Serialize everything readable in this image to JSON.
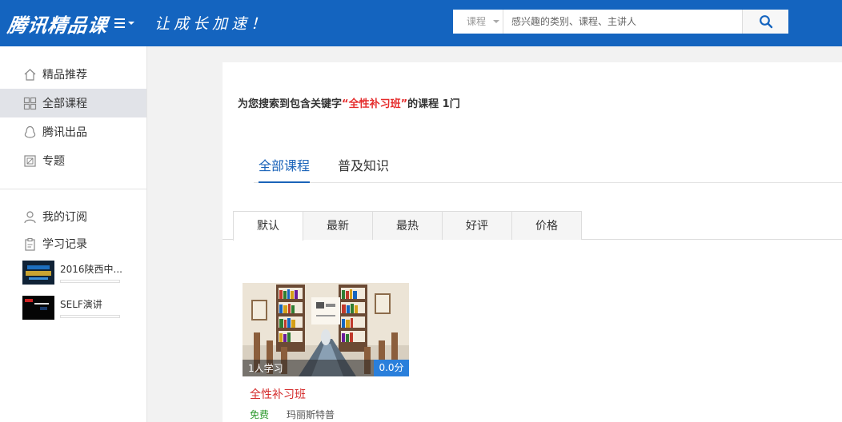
{
  "header": {
    "logo": "腾讯精品课",
    "slogan": "让成长加速！",
    "search": {
      "category": "课程",
      "placeholder": "感兴趣的类别、课程、主讲人"
    }
  },
  "sidebar": {
    "items": [
      {
        "label": "精品推荐",
        "icon": "home-icon"
      },
      {
        "label": "全部课程",
        "icon": "grid-icon",
        "active": true
      },
      {
        "label": "腾讯出品",
        "icon": "penguin-icon"
      },
      {
        "label": "专题",
        "icon": "topic-icon"
      }
    ],
    "user_items": [
      {
        "label": "我的订阅",
        "icon": "user-icon"
      },
      {
        "label": "学习记录",
        "icon": "clipboard-icon"
      }
    ],
    "recent": [
      {
        "title": "2016陕西中...",
        "progress": 0
      },
      {
        "title": "SELF演讲",
        "progress": 0
      }
    ]
  },
  "main": {
    "result": {
      "prefix": "为您搜索到包含关键字",
      "quote_open": "“",
      "keyword": "全性补习班",
      "quote_close": "”",
      "suffix": "的课程 1门"
    },
    "tabs": [
      {
        "label": "全部课程",
        "active": true
      },
      {
        "label": "普及知识",
        "active": false
      }
    ],
    "sort": [
      {
        "label": "默认",
        "active": true
      },
      {
        "label": "最新"
      },
      {
        "label": "最热"
      },
      {
        "label": "好评"
      },
      {
        "label": "价格"
      }
    ],
    "course": {
      "learners": "1人学习",
      "score": "0.0分",
      "title": "全性补习班",
      "price": "免费",
      "author": "玛丽斯特普"
    }
  },
  "colors": {
    "header": "#1464bf",
    "accent": "#1a63b9",
    "keyword": "#e52c2c",
    "free": "#2e9a2e"
  }
}
